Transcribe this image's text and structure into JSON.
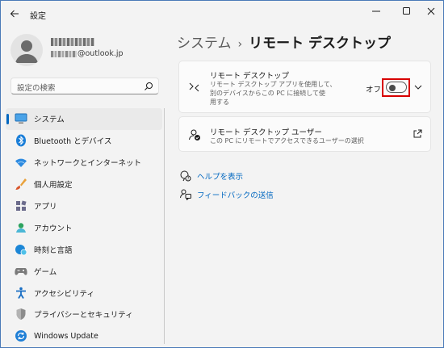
{
  "window": {
    "app_title": "設定"
  },
  "profile": {
    "email_suffix": "@outlook.jp"
  },
  "search": {
    "placeholder": "設定の検索"
  },
  "sidebar": {
    "items": [
      {
        "label": "システム",
        "icon": "monitor-icon",
        "active": true
      },
      {
        "label": "Bluetooth とデバイス",
        "icon": "bluetooth-icon"
      },
      {
        "label": "ネットワークとインターネット",
        "icon": "wifi-icon"
      },
      {
        "label": "個人用設定",
        "icon": "brush-icon"
      },
      {
        "label": "アプリ",
        "icon": "apps-icon"
      },
      {
        "label": "アカウント",
        "icon": "account-icon"
      },
      {
        "label": "時刻と言語",
        "icon": "globe-clock-icon"
      },
      {
        "label": "ゲーム",
        "icon": "gamepad-icon"
      },
      {
        "label": "アクセシビリティ",
        "icon": "accessibility-icon"
      },
      {
        "label": "プライバシーとセキュリティ",
        "icon": "shield-icon"
      },
      {
        "label": "Windows Update",
        "icon": "update-icon"
      }
    ]
  },
  "main": {
    "breadcrumb_parent": "システム",
    "breadcrumb_sep": "›",
    "breadcrumb_current": "リモート デスクトップ",
    "remote_desktop": {
      "title": "リモート デスクトップ",
      "desc_line1": "リモート デスクトップ アプリを使用して、",
      "desc_line2": "別のデバイスからこの PC に接続して使",
      "desc_line3": "用する",
      "state_label": "オフ",
      "enabled": false
    },
    "remote_users": {
      "title": "リモート デスクトップ ユーザー",
      "desc": "この PC にリモートでアクセスできるユーザーの選択"
    },
    "links": [
      {
        "label": "ヘルプを表示",
        "icon": "help-icon"
      },
      {
        "label": "フィードバックの送信",
        "icon": "feedback-icon"
      }
    ]
  },
  "colors": {
    "accent": "#0067c0",
    "highlight_box": "#d80000"
  }
}
